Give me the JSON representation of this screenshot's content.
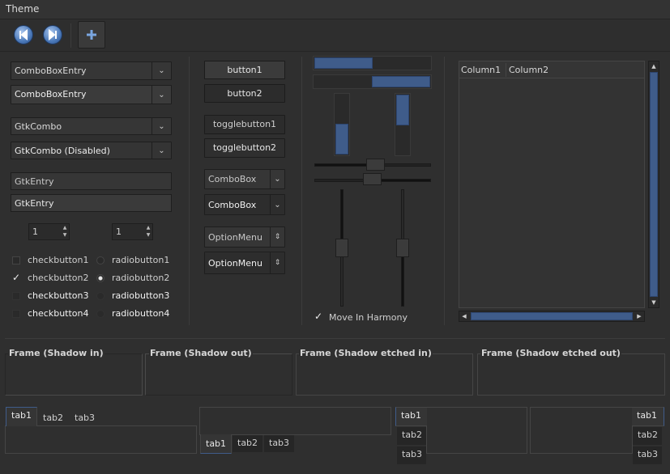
{
  "window": {
    "title": "Theme"
  },
  "toolbar": {
    "back_icon": "go-back-icon",
    "forward_icon": "go-forward-icon",
    "add_icon": "add-icon"
  },
  "left": {
    "comboentry1": "ComboBoxEntry",
    "comboentry2": "ComboBoxEntry",
    "gtkcombo1": "GtkCombo",
    "gtkcombo2": "GtkCombo (Disabled)",
    "entry1": "GtkEntry",
    "entry2": "GtkEntry",
    "spin1": "1",
    "spin2": "1",
    "checks": [
      "checkbutton1",
      "checkbutton2",
      "checkbutton3",
      "checkbutton4"
    ],
    "radios": [
      "radiobutton1",
      "radiobutton2",
      "radiobutton3",
      "radiobutton4"
    ]
  },
  "middle": {
    "button1": "button1",
    "button2": "button2",
    "toggle1": "togglebutton1",
    "toggle2": "togglebutton2",
    "combobox1": "ComboBox",
    "combobox2": "ComboBox",
    "optionmenu1": "OptionMenu",
    "optionmenu2": "OptionMenu"
  },
  "scales": {
    "harmony_label": "Move In Harmony"
  },
  "tree": {
    "columns": [
      "Column1",
      "Column2"
    ]
  },
  "frames": [
    "Frame (Shadow in)",
    "Frame (Shadow out)",
    "Frame (Shadow etched in)",
    "Frame (Shadow etched out)"
  ],
  "notebooks": {
    "nb1": [
      "tab1",
      "tab2",
      "tab3"
    ],
    "nb2": [
      "tab1",
      "tab2",
      "tab3"
    ],
    "nb3": [
      "tab1",
      "tab2",
      "tab3"
    ],
    "nb4": [
      "tab1",
      "tab2",
      "tab3"
    ]
  },
  "colors": {
    "accent": "#3f5c8a",
    "background": "#2f2f2f"
  }
}
